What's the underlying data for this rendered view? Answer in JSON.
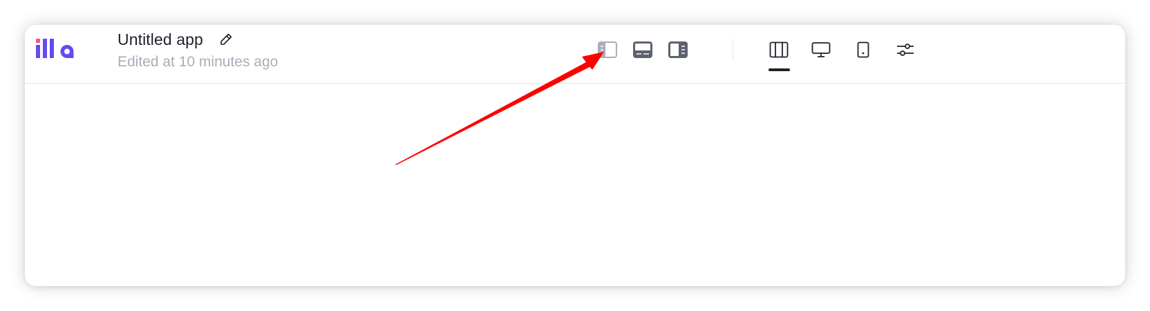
{
  "app": {
    "title": "Untitled app",
    "subtitle": "Edited at 10 minutes ago",
    "logo_text": "illa"
  },
  "toolbar": {
    "panel_toggles": [
      {
        "icon": "left-panel-icon",
        "state": "inactive"
      },
      {
        "icon": "bottom-panel-icon",
        "state": "active"
      },
      {
        "icon": "right-panel-icon",
        "state": "active"
      }
    ],
    "view_modes": [
      {
        "icon": "canvas-layout-icon",
        "selected": true
      },
      {
        "icon": "desktop-icon",
        "selected": false
      },
      {
        "icon": "tablet-icon",
        "selected": false
      },
      {
        "icon": "settings-sliders-icon",
        "selected": false
      }
    ]
  },
  "annotation": {
    "color": "#ff0000",
    "points_to": "left-panel-toggle"
  },
  "colors": {
    "brand_purple": "#654aec",
    "brand_pink": "#ff4e9c",
    "text_primary": "#1d2129",
    "text_secondary": "#a9aeb8",
    "icon_inactive": "#a9aeb8",
    "icon_active": "#5c626e",
    "border": "#e5e6eb"
  }
}
